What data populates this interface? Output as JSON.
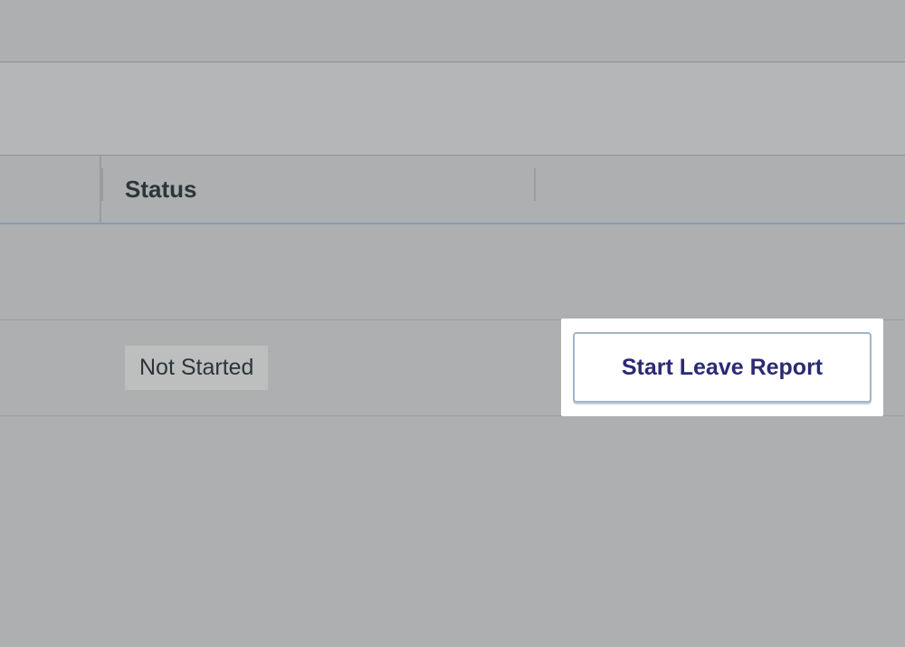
{
  "table": {
    "headers": {
      "status": "Status"
    },
    "row": {
      "status_badge": "Not Started",
      "action_button": "Start Leave Report"
    }
  }
}
